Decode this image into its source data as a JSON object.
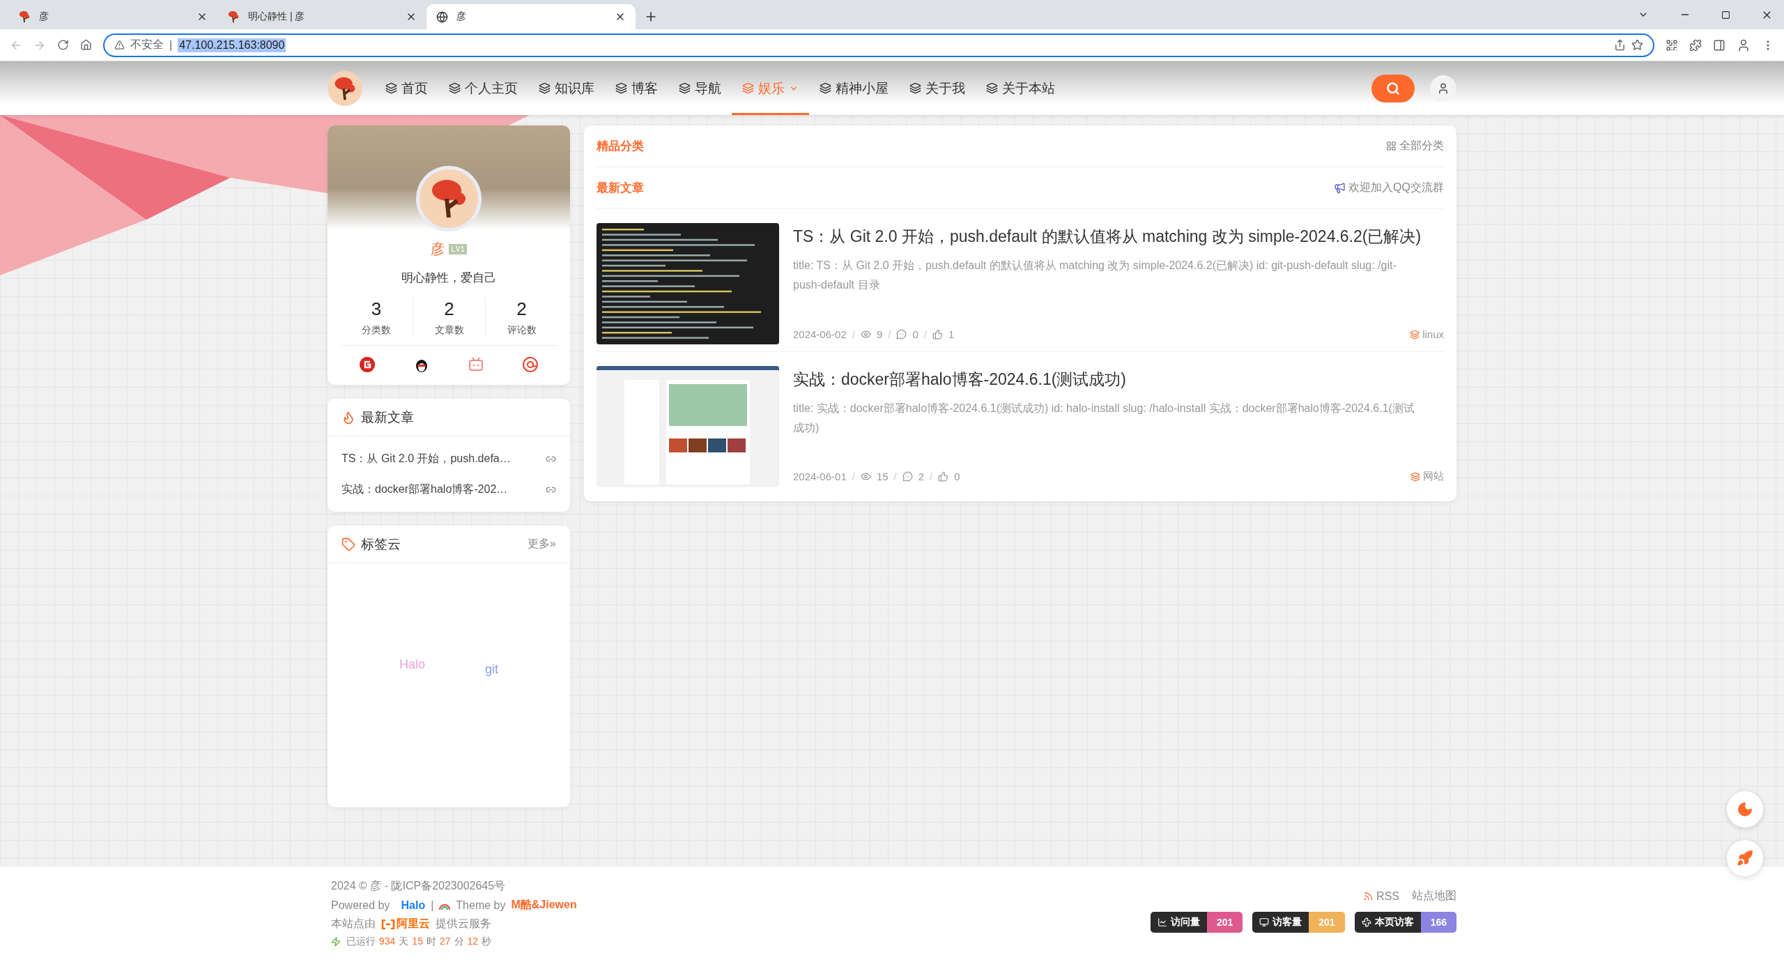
{
  "browser": {
    "tabs": [
      {
        "title": "彦",
        "selected": false
      },
      {
        "title": "明心静性 | 彦",
        "selected": false
      },
      {
        "title": "彦",
        "selected": true
      }
    ],
    "security_label": "不安全",
    "security_separator": "|",
    "url": "47.100.215.163:8090"
  },
  "nav": {
    "items": [
      {
        "label": "首页",
        "selected": false,
        "dropdown": false
      },
      {
        "label": "个人主页",
        "selected": false,
        "dropdown": false
      },
      {
        "label": "知识库",
        "selected": false,
        "dropdown": false
      },
      {
        "label": "博客",
        "selected": false,
        "dropdown": false
      },
      {
        "label": "导航",
        "selected": false,
        "dropdown": false
      },
      {
        "label": "娱乐",
        "selected": true,
        "dropdown": true
      },
      {
        "label": "精神小屋",
        "selected": false,
        "dropdown": false
      },
      {
        "label": "关于我",
        "selected": false,
        "dropdown": false
      },
      {
        "label": "关于本站",
        "selected": false,
        "dropdown": false
      }
    ]
  },
  "profile": {
    "name": "彦",
    "level": "LV1",
    "motto": "明心静性，爱自己",
    "stats": [
      {
        "value": "3",
        "label": "分类数"
      },
      {
        "value": "2",
        "label": "文章数"
      },
      {
        "value": "2",
        "label": "评论数"
      }
    ]
  },
  "recent_widget": {
    "title": "最新文章",
    "items": [
      "TS：从 Git 2.0 开始，push.defa…",
      "实战：docker部署halo博客-202…"
    ]
  },
  "tag_cloud": {
    "title": "标签云",
    "more": "更多»",
    "tags": [
      {
        "label": "Halo",
        "color": "#f0a0dc"
      },
      {
        "label": "git",
        "color": "#8a9cf0"
      }
    ]
  },
  "main": {
    "featured_title": "精品分类",
    "all_categories": "全部分类",
    "latest_title": "最新文章",
    "qq_group": "欢迎加入QQ交流群",
    "meta_separator": "/",
    "posts": [
      {
        "title": "TS：从 Git 2.0 开始，push.default 的默认值将从 matching 改为 simple-2024.6.2(已解决)",
        "excerpt": "title: TS：从 Git 2.0 开始，push.default 的默认值将从 matching 改为 simple-2024.6.2(已解决) id: git-push-default slug: /git-push-default 目录",
        "date": "2024-06-02",
        "views": "9",
        "comments": "0",
        "likes": "1",
        "category": "linux"
      },
      {
        "title": "实战：docker部署halo博客-2024.6.1(测试成功)",
        "excerpt": "title: 实战：docker部署halo博客-2024.6.1(测试成功) id: halo-install slug: /halo-install 实战：docker部署halo博客-2024.6.1(测试成功)",
        "date": "2024-06-01",
        "views": "15",
        "comments": "2",
        "likes": "0",
        "category": "网站"
      }
    ]
  },
  "footer": {
    "copyright": "2024 © 彦  -  陇ICP备2023002645号",
    "powered_by": "Powered by",
    "halo": "Halo",
    "separator": "|",
    "theme_by": "Theme by",
    "theme_author": "M酷&Jiewen",
    "hosting_prefix": "本站点由",
    "hosting_brand": "阿里云",
    "hosting_suffix": "提供云服务",
    "uptime": [
      {
        "text": "已运行",
        "kind": "label"
      },
      {
        "text": "934",
        "kind": "number"
      },
      {
        "text": "天",
        "kind": "label"
      },
      {
        "text": "15",
        "kind": "number"
      },
      {
        "text": "时",
        "kind": "label"
      },
      {
        "text": "27",
        "kind": "number"
      },
      {
        "text": "分",
        "kind": "label"
      },
      {
        "text": "12",
        "kind": "number"
      },
      {
        "text": "秒",
        "kind": "label"
      }
    ],
    "links": [
      "RSS",
      "站点地图"
    ],
    "badges": [
      {
        "label": "访问量",
        "value": "201",
        "color": "#de5a8c"
      },
      {
        "label": "访客量",
        "value": "201",
        "color": "#f0b35a"
      },
      {
        "label": "本页访客",
        "value": "166",
        "color": "#8c84e0"
      }
    ]
  }
}
